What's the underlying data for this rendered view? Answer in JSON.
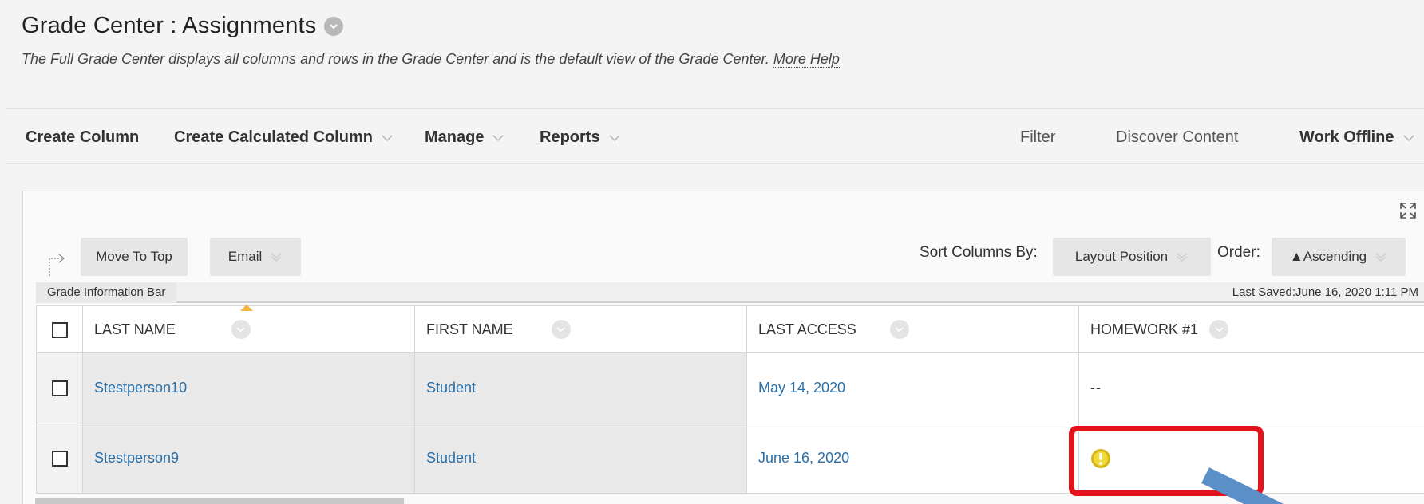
{
  "header": {
    "title": "Grade Center : Assignments",
    "description": "The Full Grade Center displays all columns and rows in the Grade Center and is the default view of the Grade Center.",
    "help_link": "More Help"
  },
  "action_bar": {
    "create_column": "Create Column",
    "create_calculated_column": "Create Calculated Column",
    "manage": "Manage",
    "reports": "Reports",
    "filter": "Filter",
    "discover_content": "Discover Content",
    "work_offline": "Work Offline"
  },
  "toolbar": {
    "move_to_top": "Move To Top",
    "email": "Email",
    "sort_columns_by_label": "Sort Columns By:",
    "sort_columns_by_value": "Layout Position",
    "order_label": "Order:",
    "order_value": "▲Ascending"
  },
  "info_bar": {
    "tab": "Grade Information Bar",
    "last_saved": "Last Saved:June 16, 2020 1:11 PM"
  },
  "grid": {
    "columns": [
      "LAST NAME",
      "FIRST NAME",
      "LAST ACCESS",
      "HOMEWORK #1"
    ],
    "rows": [
      {
        "last_name": "Stestperson10",
        "first_name": "Student",
        "last_access": "May 14, 2020",
        "homework1": "--"
      },
      {
        "last_name": "Stestperson9",
        "first_name": "Student",
        "last_access": "June 16, 2020",
        "homework1": "needs-grading-icon"
      }
    ]
  },
  "colors": {
    "link": "#2a6fa8",
    "highlight": "#e3131b",
    "annotation_arrow": "#5b8fc7",
    "needs_grading": "#d4b51a"
  }
}
